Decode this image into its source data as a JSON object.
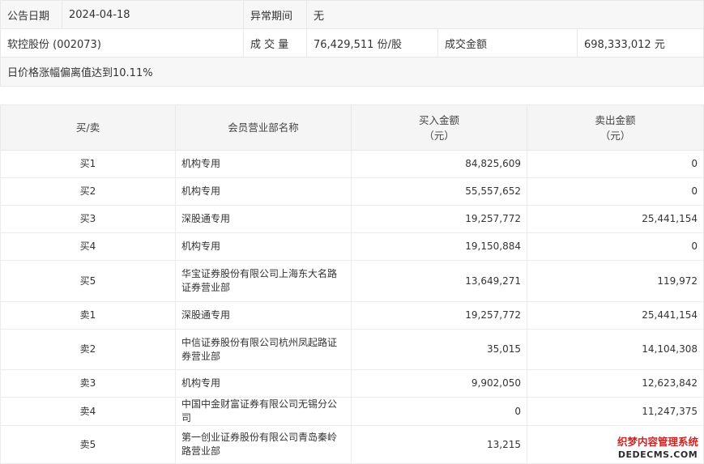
{
  "info": {
    "announce_date_label": "公告日期",
    "announce_date": "2024-04-18",
    "abnormal_period_label": "异常期间",
    "abnormal_period": "无",
    "stock": "软控股份 (002073)",
    "volume_label": "成 交 量",
    "volume": "76,429,511 份/股",
    "amount_label": "成交金额",
    "amount": "698,333,012 元",
    "reason": "日价格涨幅偏离值达到10.11%"
  },
  "table": {
    "headers": {
      "side": "买/卖",
      "broker": "会员营业部名称",
      "buy_line1": "买入金额",
      "buy_line2": "（元）",
      "sell_line1": "卖出金额",
      "sell_line2": "（元）"
    },
    "rows": [
      {
        "side": "买1",
        "broker": "机构专用",
        "buy": "84,825,609",
        "sell": "0"
      },
      {
        "side": "买2",
        "broker": "机构专用",
        "buy": "55,557,652",
        "sell": "0"
      },
      {
        "side": "买3",
        "broker": "深股通专用",
        "buy": "19,257,772",
        "sell": "25,441,154"
      },
      {
        "side": "买4",
        "broker": "机构专用",
        "buy": "19,150,884",
        "sell": "0"
      },
      {
        "side": "买5",
        "broker": "华宝证券股份有限公司上海东大名路证券营业部",
        "buy": "13,649,271",
        "sell": "119,972"
      },
      {
        "side": "卖1",
        "broker": "深股通专用",
        "buy": "19,257,772",
        "sell": "25,441,154"
      },
      {
        "side": "卖2",
        "broker": "中信证券股份有限公司杭州凤起路证券营业部",
        "buy": "35,015",
        "sell": "14,104,308"
      },
      {
        "side": "卖3",
        "broker": "机构专用",
        "buy": "9,902,050",
        "sell": "12,623,842"
      },
      {
        "side": "卖4",
        "broker": "中国中金财富证券有限公司无锡分公司",
        "buy": "0",
        "sell": "11,247,375"
      },
      {
        "side": "卖5",
        "broker": "第一创业证券股份有限公司青岛秦岭路营业部",
        "buy": "13,215",
        "sell": ""
      }
    ]
  },
  "watermark": {
    "line1": "织梦内容管理系统",
    "line2": "DEDECMS.COM"
  }
}
